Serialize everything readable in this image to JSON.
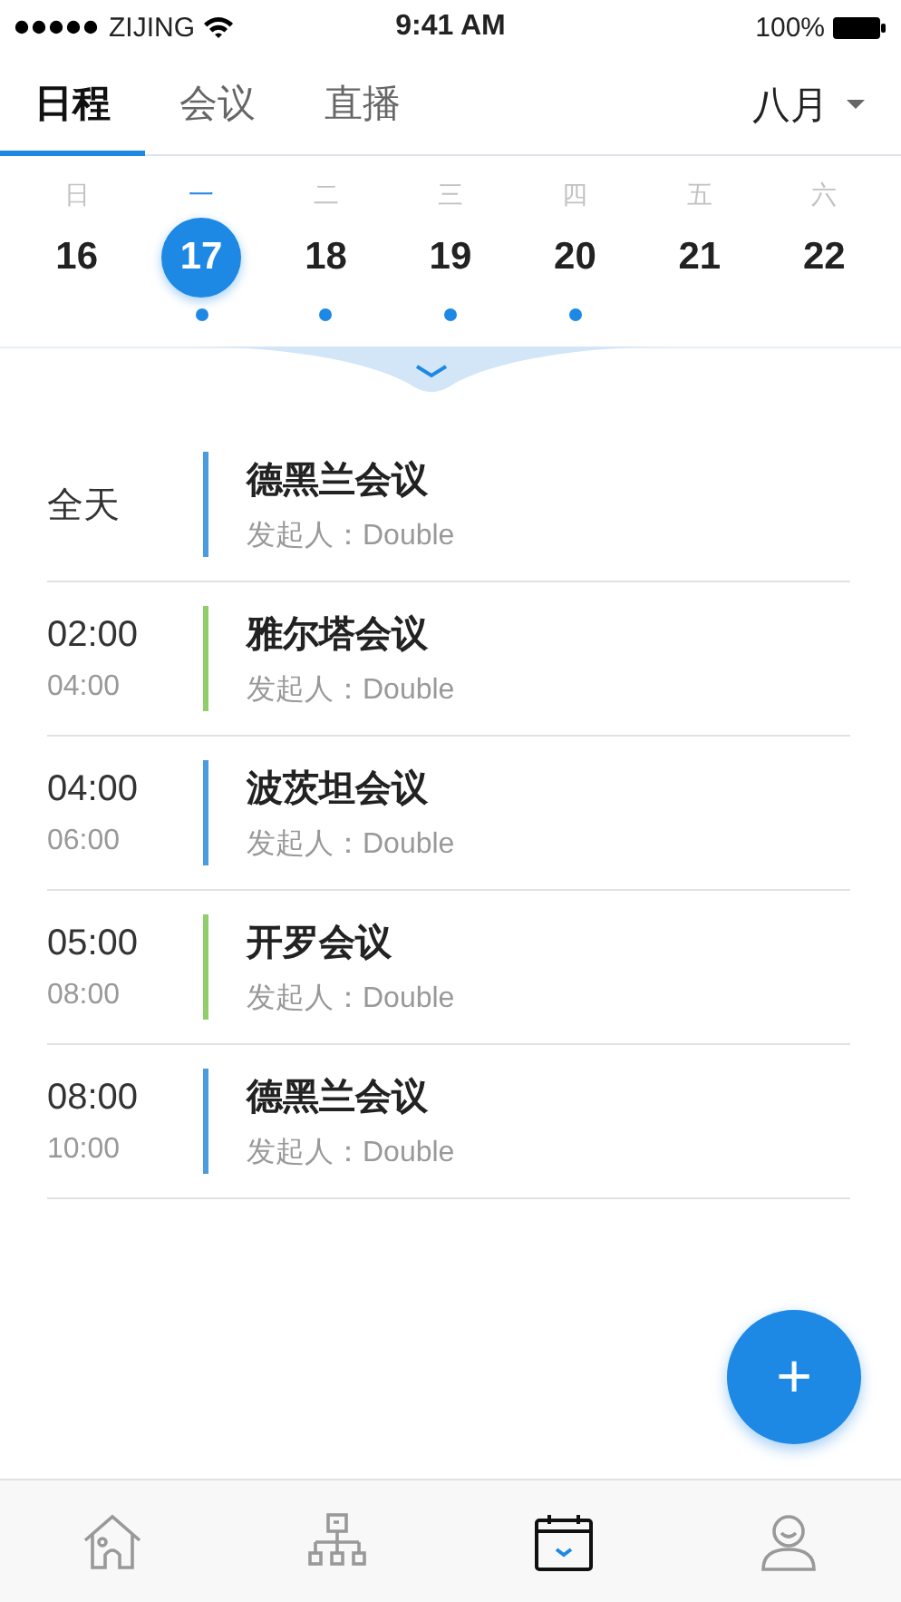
{
  "status_bar": {
    "carrier": "ZIJING",
    "time": "9:41 AM",
    "battery": "100%"
  },
  "tabs": [
    {
      "label": "日程",
      "selected": true
    },
    {
      "label": "会议",
      "selected": false
    },
    {
      "label": "直播",
      "selected": false
    }
  ],
  "month_picker": {
    "label": "八月"
  },
  "week": [
    {
      "weekday": "日",
      "date": "16",
      "selected": false,
      "has_event": false
    },
    {
      "weekday": "一",
      "date": "17",
      "selected": true,
      "has_event": true
    },
    {
      "weekday": "二",
      "date": "18",
      "selected": false,
      "has_event": true
    },
    {
      "weekday": "三",
      "date": "19",
      "selected": false,
      "has_event": true
    },
    {
      "weekday": "四",
      "date": "20",
      "selected": false,
      "has_event": true
    },
    {
      "weekday": "五",
      "date": "21",
      "selected": false,
      "has_event": false
    },
    {
      "weekday": "六",
      "date": "22",
      "selected": false,
      "has_event": false
    }
  ],
  "events": [
    {
      "start": "全天",
      "title": "德黑兰会议",
      "organizer": "发起人：Double",
      "color": "#4a9be0"
    },
    {
      "start": "02:00",
      "end": "04:00",
      "title": "雅尔塔会议",
      "organizer": "发起人：Double",
      "color": "#8fce6a"
    },
    {
      "start": "04:00",
      "end": "06:00",
      "title": "波茨坦会议",
      "organizer": "发起人：Double",
      "color": "#4a9be0"
    },
    {
      "start": "05:00",
      "end": "08:00",
      "title": "开罗会议",
      "organizer": "发起人：Double",
      "color": "#8fce6a"
    },
    {
      "start": "08:00",
      "end": "10:00",
      "title": "德黑兰会议",
      "organizer": "发起人：Double",
      "color": "#4a9be0"
    }
  ],
  "fab": {
    "label": "+"
  },
  "nav": [
    {
      "kind": "home",
      "selected": false
    },
    {
      "kind": "org",
      "selected": false
    },
    {
      "kind": "calendar",
      "selected": true
    },
    {
      "kind": "profile",
      "selected": false
    }
  ]
}
